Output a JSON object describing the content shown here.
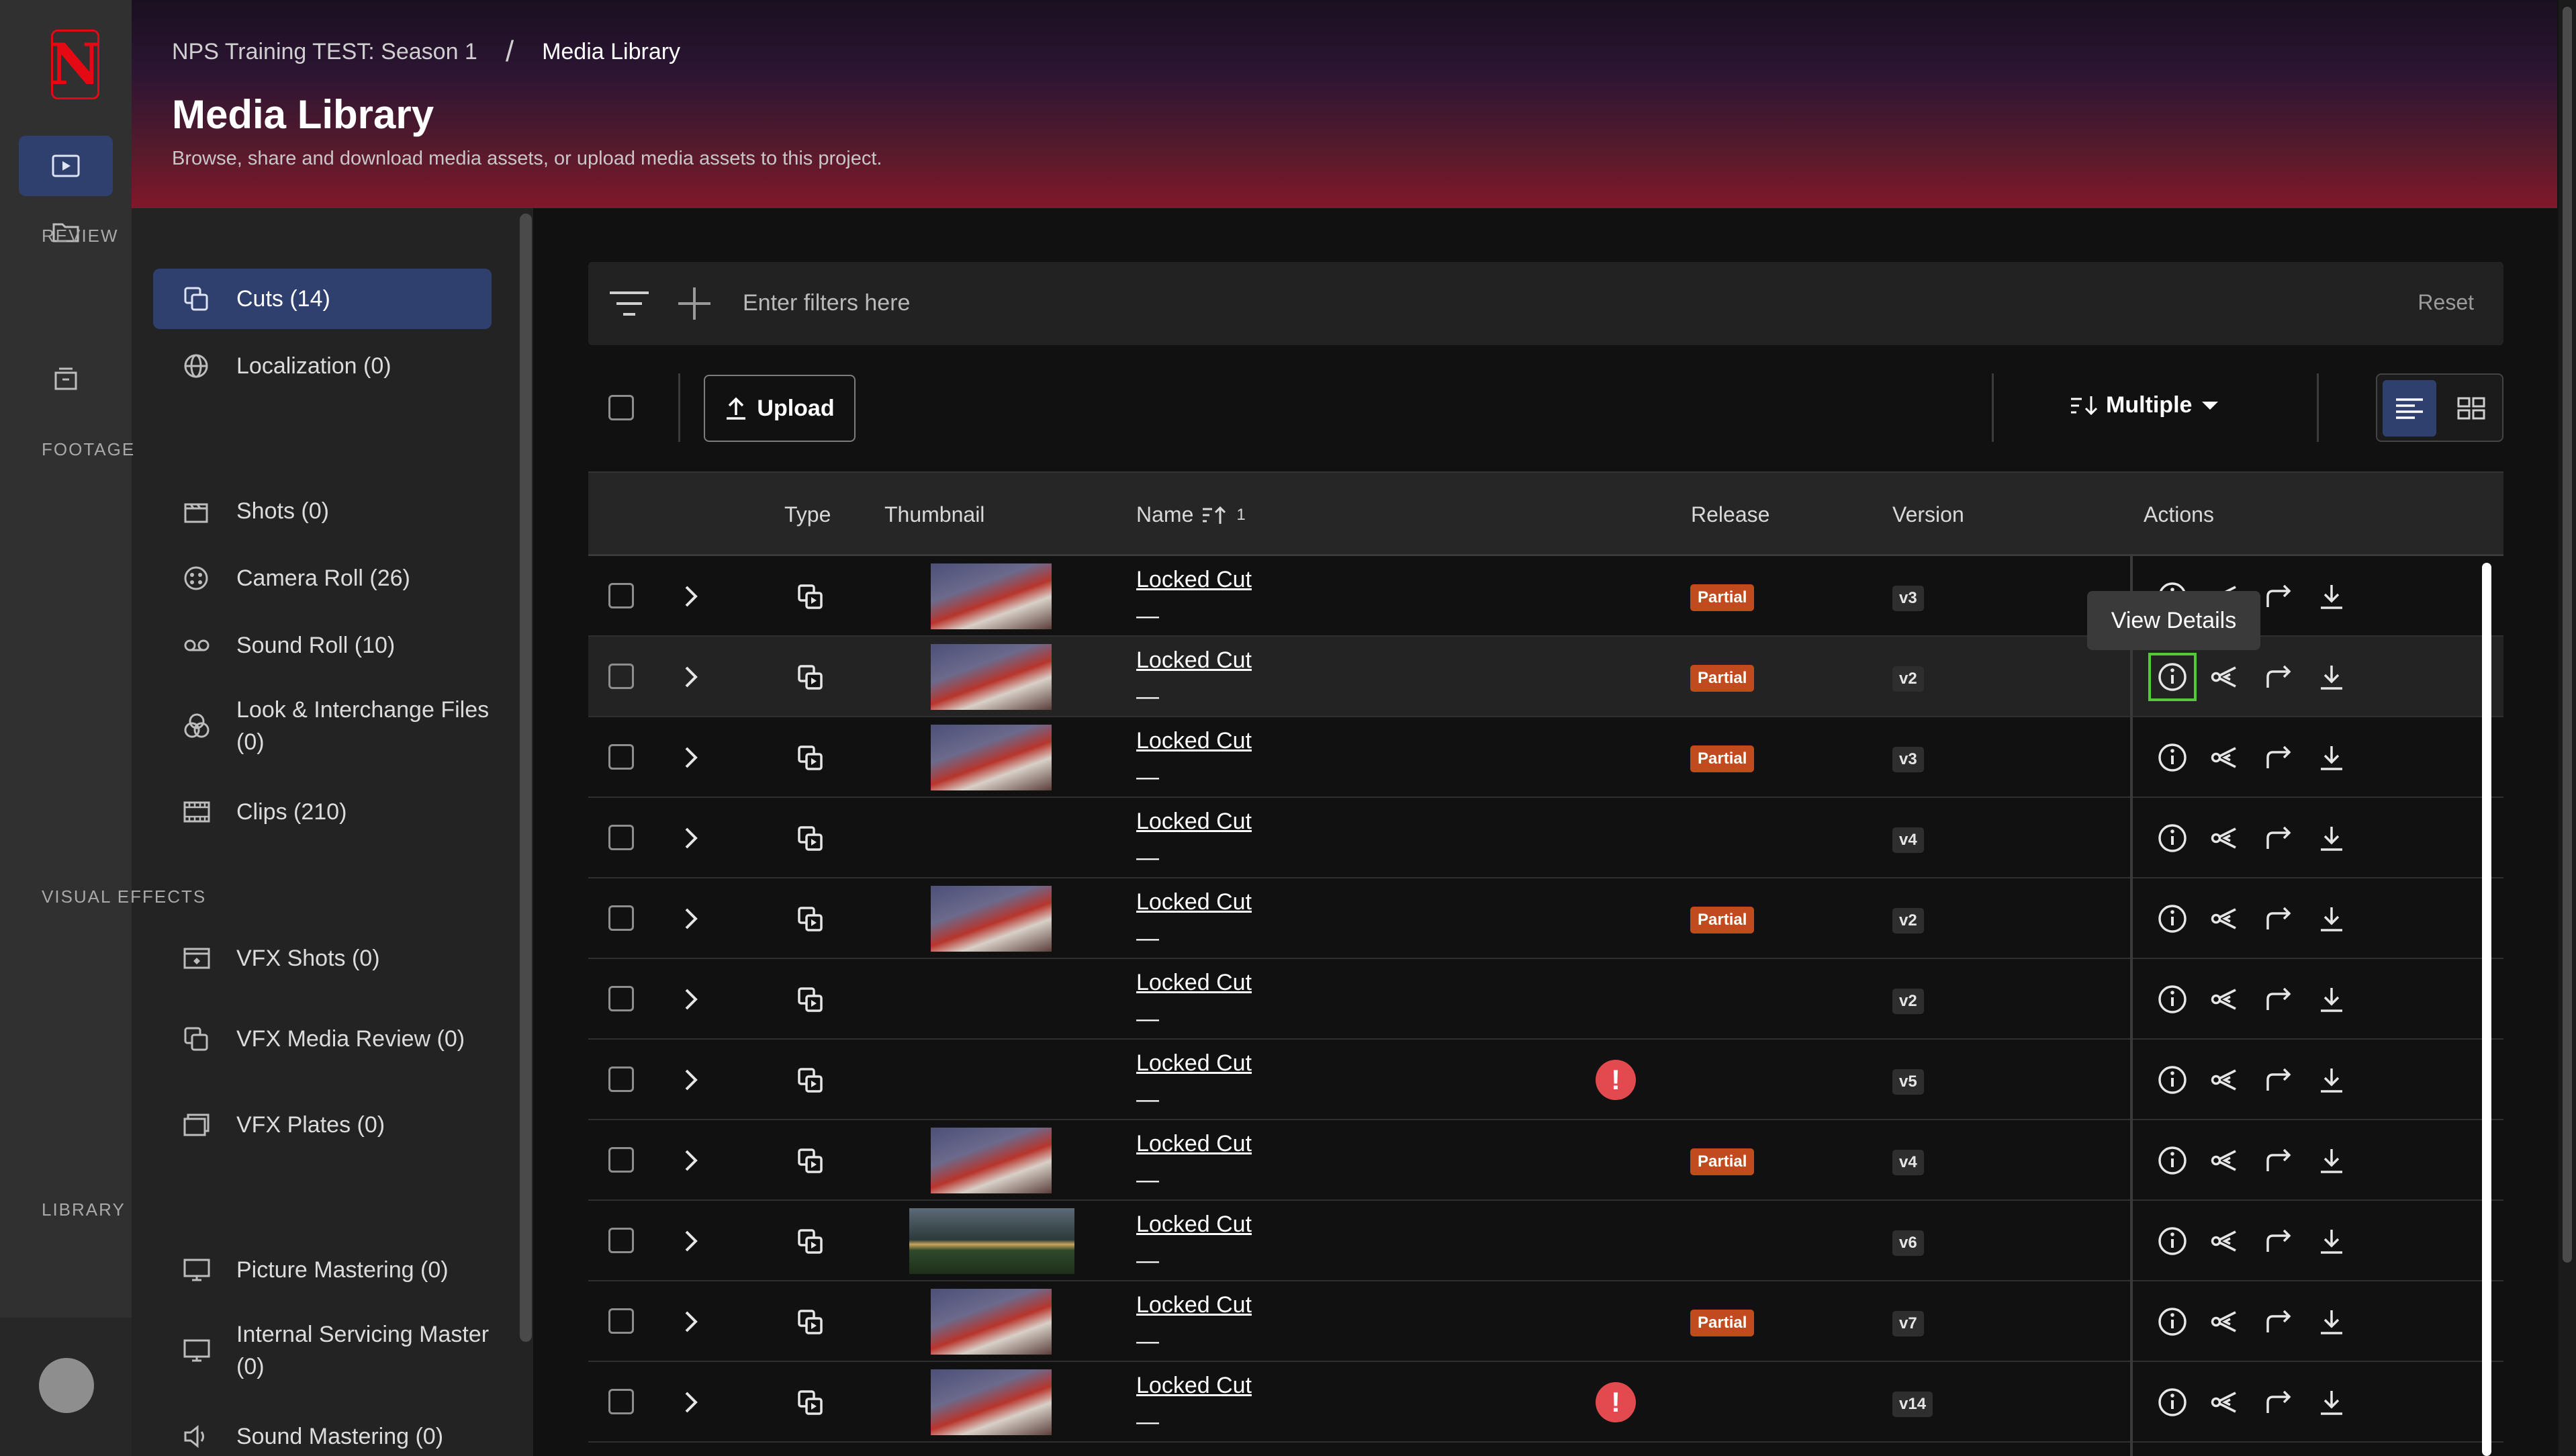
{
  "app": {
    "logo_letter": "N",
    "brand_color": "#e50914",
    "accent_color": "#2f3f6e"
  },
  "header": {
    "breadcrumb_project": "NPS Training TEST: Season 1",
    "breadcrumb_separator": "/",
    "breadcrumb_current": "Media Library",
    "title": "Media Library",
    "subtitle": "Browse, share and download media assets, or upload media assets to this project."
  },
  "rail": {
    "items": [
      "play-icon",
      "folder-icon",
      "archive-icon"
    ]
  },
  "sidebar": {
    "sections": [
      {
        "title": "REVIEW",
        "items": [
          {
            "label": "Cuts (14)",
            "icon": "cuts-icon",
            "active": true
          },
          {
            "label": "Localization (0)",
            "icon": "globe-icon"
          }
        ]
      },
      {
        "title": "FOOTAGE",
        "items": [
          {
            "label": "Shots (0)",
            "icon": "clapper-icon"
          },
          {
            "label": "Camera Roll (26)",
            "icon": "camera-roll-icon"
          },
          {
            "label": "Sound Roll (10)",
            "icon": "tape-icon"
          },
          {
            "label": "Look & Interchange Files (0)",
            "icon": "look-icon"
          },
          {
            "label": "Clips (210)",
            "icon": "film-icon"
          }
        ]
      },
      {
        "title": "VISUAL EFFECTS",
        "items": [
          {
            "label": "VFX Shots (0)",
            "icon": "vfx-shot-icon"
          },
          {
            "label": "VFX Media Review (0)",
            "icon": "vfx-review-icon"
          },
          {
            "label": "VFX Plates (0)",
            "icon": "vfx-plates-icon"
          }
        ]
      },
      {
        "title": "LIBRARY",
        "items": [
          {
            "label": "Picture Mastering (0)",
            "icon": "monitor-icon"
          },
          {
            "label": "Internal Servicing Master (0)",
            "icon": "monitor-icon"
          },
          {
            "label": "Sound Mastering (0)",
            "icon": "speaker-icon"
          }
        ]
      }
    ]
  },
  "filters": {
    "placeholder": "Enter filters here",
    "reset_label": "Reset"
  },
  "toolbar": {
    "upload_label": "Upload",
    "sort_label": "Multiple"
  },
  "table": {
    "columns": {
      "type": "Type",
      "thumbnail": "Thumbnail",
      "name": "Name",
      "sort_indicator": "1",
      "release": "Release",
      "version": "Version",
      "actions": "Actions"
    },
    "rows": [
      {
        "name": "Locked Cut",
        "sub": "—",
        "thumb": "fire",
        "release": "Partial",
        "version": "v3",
        "alert": false
      },
      {
        "name": "Locked Cut",
        "sub": "—",
        "thumb": "fire",
        "release": "Partial",
        "version": "v2",
        "alert": false
      },
      {
        "name": "Locked Cut",
        "sub": "—",
        "thumb": "fire",
        "release": "Partial",
        "version": "v3",
        "alert": false
      },
      {
        "name": "Locked Cut",
        "sub": "—",
        "thumb": "",
        "release": "",
        "version": "v4",
        "alert": false
      },
      {
        "name": "Locked Cut",
        "sub": "—",
        "thumb": "fire",
        "release": "Partial",
        "version": "v2",
        "alert": false
      },
      {
        "name": "Locked Cut",
        "sub": "—",
        "thumb": "",
        "release": "",
        "version": "v2",
        "alert": false
      },
      {
        "name": "Locked Cut",
        "sub": "—",
        "thumb": "",
        "release": "",
        "version": "v5",
        "alert": true
      },
      {
        "name": "Locked Cut",
        "sub": "—",
        "thumb": "fire",
        "release": "Partial",
        "version": "v4",
        "alert": false
      },
      {
        "name": "Locked Cut",
        "sub": "—",
        "thumb": "landscape",
        "release": "",
        "version": "v6",
        "alert": false
      },
      {
        "name": "Locked Cut",
        "sub": "—",
        "thumb": "fire",
        "release": "Partial",
        "version": "v7",
        "alert": false
      },
      {
        "name": "Locked Cut",
        "sub": "—",
        "thumb": "fire",
        "release": "",
        "version": "v14",
        "alert": true
      }
    ]
  },
  "tooltip": {
    "text": "View Details"
  },
  "alert_glyph": "!"
}
